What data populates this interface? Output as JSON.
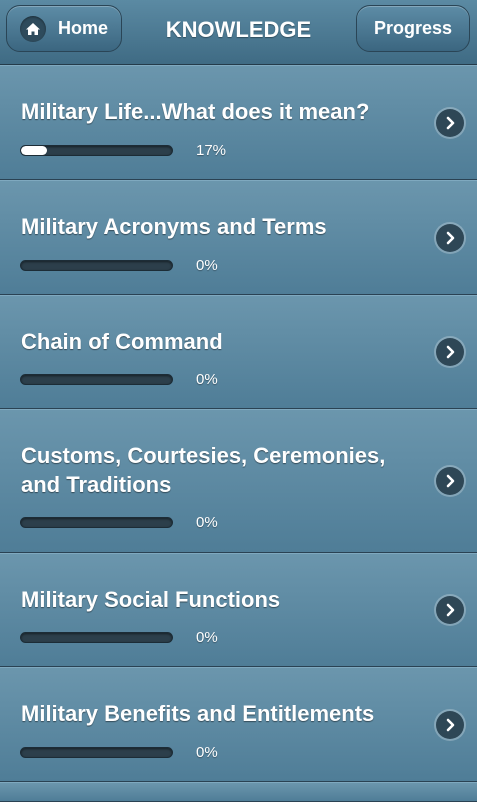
{
  "header": {
    "home_label": "Home",
    "title": "KNOWLEDGE",
    "progress_label": "Progress"
  },
  "items": [
    {
      "title": "Military Life...What does it mean?",
      "progress": 17,
      "progress_text": "17%"
    },
    {
      "title": "Military Acronyms and Terms",
      "progress": 0,
      "progress_text": "0%"
    },
    {
      "title": "Chain of Command",
      "progress": 0,
      "progress_text": "0%"
    },
    {
      "title": "Customs, Courtesies, Ceremonies, and Traditions",
      "progress": 0,
      "progress_text": "0%"
    },
    {
      "title": "Military Social Functions",
      "progress": 0,
      "progress_text": "0%"
    },
    {
      "title": "Military Benefits and Entitlements",
      "progress": 0,
      "progress_text": "0%"
    }
  ]
}
